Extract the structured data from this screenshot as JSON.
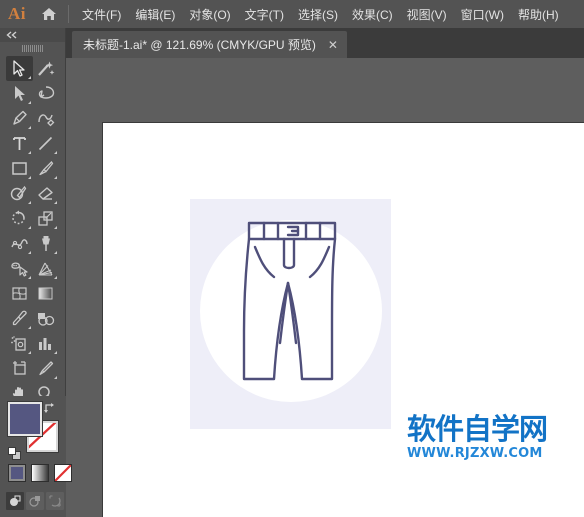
{
  "app": {
    "logo_text": "Ai",
    "home_icon": "home-icon"
  },
  "menubar": {
    "items": [
      {
        "label": "文件(F)",
        "name": "menu-file"
      },
      {
        "label": "编辑(E)",
        "name": "menu-edit"
      },
      {
        "label": "对象(O)",
        "name": "menu-object"
      },
      {
        "label": "文字(T)",
        "name": "menu-type"
      },
      {
        "label": "选择(S)",
        "name": "menu-select"
      },
      {
        "label": "效果(C)",
        "name": "menu-effect"
      },
      {
        "label": "视图(V)",
        "name": "menu-view"
      },
      {
        "label": "窗口(W)",
        "name": "menu-window"
      },
      {
        "label": "帮助(H)",
        "name": "menu-help"
      }
    ]
  },
  "tab": {
    "title": "未标题-1.ai* @ 121.69% (CMYK/GPU 预览)",
    "document_name": "未标题-1.ai*",
    "zoom_level": "121.69%",
    "color_mode": "CMYK/GPU 预览",
    "close_label": "✕"
  },
  "toolbar": {
    "collapse_icon": "double-chevron-left-icon",
    "grip_icon": "drag-grip-icon",
    "tools": [
      {
        "name": "selection-tool",
        "icon": "arrow-cursor-icon",
        "active": true,
        "corner": true
      },
      {
        "name": "magic-wand-tool",
        "icon": "magic-wand-icon",
        "active": false,
        "corner": false
      },
      {
        "name": "direct-selection-tool",
        "icon": "white-arrow-icon",
        "active": false,
        "corner": true
      },
      {
        "name": "lasso-tool",
        "icon": "lasso-icon",
        "active": false,
        "corner": false
      },
      {
        "name": "pen-tool",
        "icon": "pen-nib-icon",
        "active": false,
        "corner": true
      },
      {
        "name": "curvature-tool",
        "icon": "curvature-icon",
        "active": false,
        "corner": false
      },
      {
        "name": "type-tool",
        "icon": "text-t-icon",
        "active": false,
        "corner": true
      },
      {
        "name": "line-segment-tool",
        "icon": "diagonal-line-icon",
        "active": false,
        "corner": true
      },
      {
        "name": "rectangle-tool",
        "icon": "rectangle-icon",
        "active": false,
        "corner": true
      },
      {
        "name": "paintbrush-tool",
        "icon": "paintbrush-icon",
        "active": false,
        "corner": true
      },
      {
        "name": "shaper-tool",
        "icon": "shaper-pencil-icon",
        "active": false,
        "corner": true
      },
      {
        "name": "eraser-tool",
        "icon": "eraser-icon",
        "active": false,
        "corner": true
      },
      {
        "name": "rotate-tool",
        "icon": "rotate-arrow-icon",
        "active": false,
        "corner": true
      },
      {
        "name": "scale-tool",
        "icon": "scale-squares-icon",
        "active": false,
        "corner": true
      },
      {
        "name": "width-tool",
        "icon": "width-warp-icon",
        "active": false,
        "corner": true
      },
      {
        "name": "free-transform-tool",
        "icon": "pushpin-icon",
        "active": false,
        "corner": true
      },
      {
        "name": "shape-builder-tool",
        "icon": "shape-builder-icon",
        "active": false,
        "corner": true
      },
      {
        "name": "perspective-grid-tool",
        "icon": "perspective-grid-icon",
        "active": false,
        "corner": true
      },
      {
        "name": "mesh-tool",
        "icon": "mesh-icon",
        "active": false,
        "corner": false
      },
      {
        "name": "gradient-tool",
        "icon": "gradient-icon",
        "active": false,
        "corner": false
      },
      {
        "name": "eyedropper-tool",
        "icon": "eyedropper-icon",
        "active": false,
        "corner": true
      },
      {
        "name": "blend-tool",
        "icon": "blend-circles-icon",
        "active": false,
        "corner": false
      },
      {
        "name": "symbol-sprayer-tool",
        "icon": "symbol-sprayer-icon",
        "active": false,
        "corner": true
      },
      {
        "name": "column-graph-tool",
        "icon": "bar-chart-icon",
        "active": false,
        "corner": true
      },
      {
        "name": "artboard-tool",
        "icon": "artboard-icon",
        "active": false,
        "corner": false
      },
      {
        "name": "slice-tool",
        "icon": "slice-knife-icon",
        "active": false,
        "corner": true
      },
      {
        "name": "hand-tool",
        "icon": "hand-icon",
        "active": false,
        "corner": true
      },
      {
        "name": "zoom-tool",
        "icon": "magnifier-icon",
        "active": false,
        "corner": false
      }
    ]
  },
  "color_controls": {
    "fill_color": "#555781",
    "stroke_color": "#ffffff",
    "stroke_is_none": true,
    "swap_icon": "swap-fill-stroke-icon",
    "default_icon": "default-fill-stroke-icon",
    "fill_modes": [
      {
        "name": "color-mode-button",
        "icon": "solid-color-icon",
        "selected": true
      },
      {
        "name": "gradient-mode-button",
        "icon": "gradient-icon",
        "selected": false
      },
      {
        "name": "none-mode-button",
        "icon": "none-slash-icon",
        "selected": false
      }
    ],
    "draw_modes": [
      {
        "name": "draw-normal-button",
        "icon": "draw-normal-icon",
        "selected": true
      },
      {
        "name": "draw-behind-button",
        "icon": "draw-behind-icon",
        "selected": false
      },
      {
        "name": "draw-inside-button",
        "icon": "draw-inside-icon",
        "selected": false
      }
    ]
  },
  "artwork": {
    "background_square_color": "#eeeef8",
    "circle_color": "#ffffff",
    "line_color": "#4f4f7a",
    "subject": "trousers-line-icon"
  },
  "watermark": {
    "main_text": "软件自学网",
    "sub_text": "WWW.RJZXW.COM",
    "color": "#1273c6"
  }
}
